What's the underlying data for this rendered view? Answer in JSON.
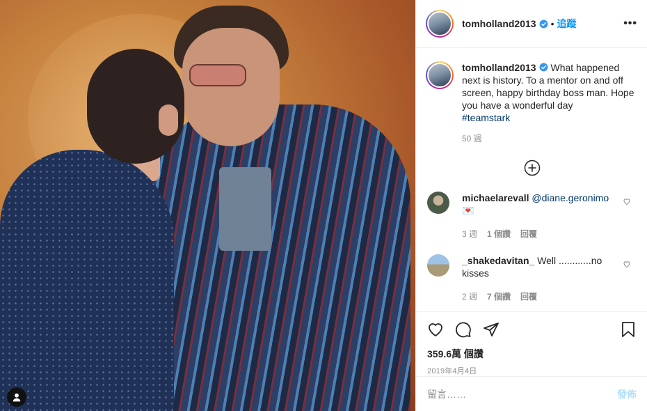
{
  "post": {
    "username": "tomholland2013",
    "follow_label": "追蹤",
    "more_label": "•••",
    "photo_alt": "Photo"
  },
  "caption": {
    "username": "tomholland2013",
    "text": "What happened next is history. To a mentor on and off screen, happy birthday boss man. Hope you have a wonderful day",
    "hashtag": "#teamstark",
    "age": "50 週"
  },
  "comments": [
    {
      "username": "michaelarevall",
      "mention": "@diane.geronimo",
      "emoji": "💌",
      "age": "3 週",
      "likes": "1 個讚",
      "reply": "回覆"
    },
    {
      "username": "_shakedavitan_",
      "text": "Well ............no kisses",
      "age": "2 週",
      "likes": "7 個讚",
      "reply": "回覆"
    }
  ],
  "stats": {
    "views": "359.6萬 個讚",
    "date": "2019年4月4日"
  },
  "add_comment": {
    "placeholder": "留言……",
    "post_label": "發佈"
  },
  "colors": {
    "link_blue": "#0095f6",
    "hashtag_blue": "#00376b",
    "muted_gray": "#8e8e8e",
    "post_disabled": "#b2dffc"
  }
}
